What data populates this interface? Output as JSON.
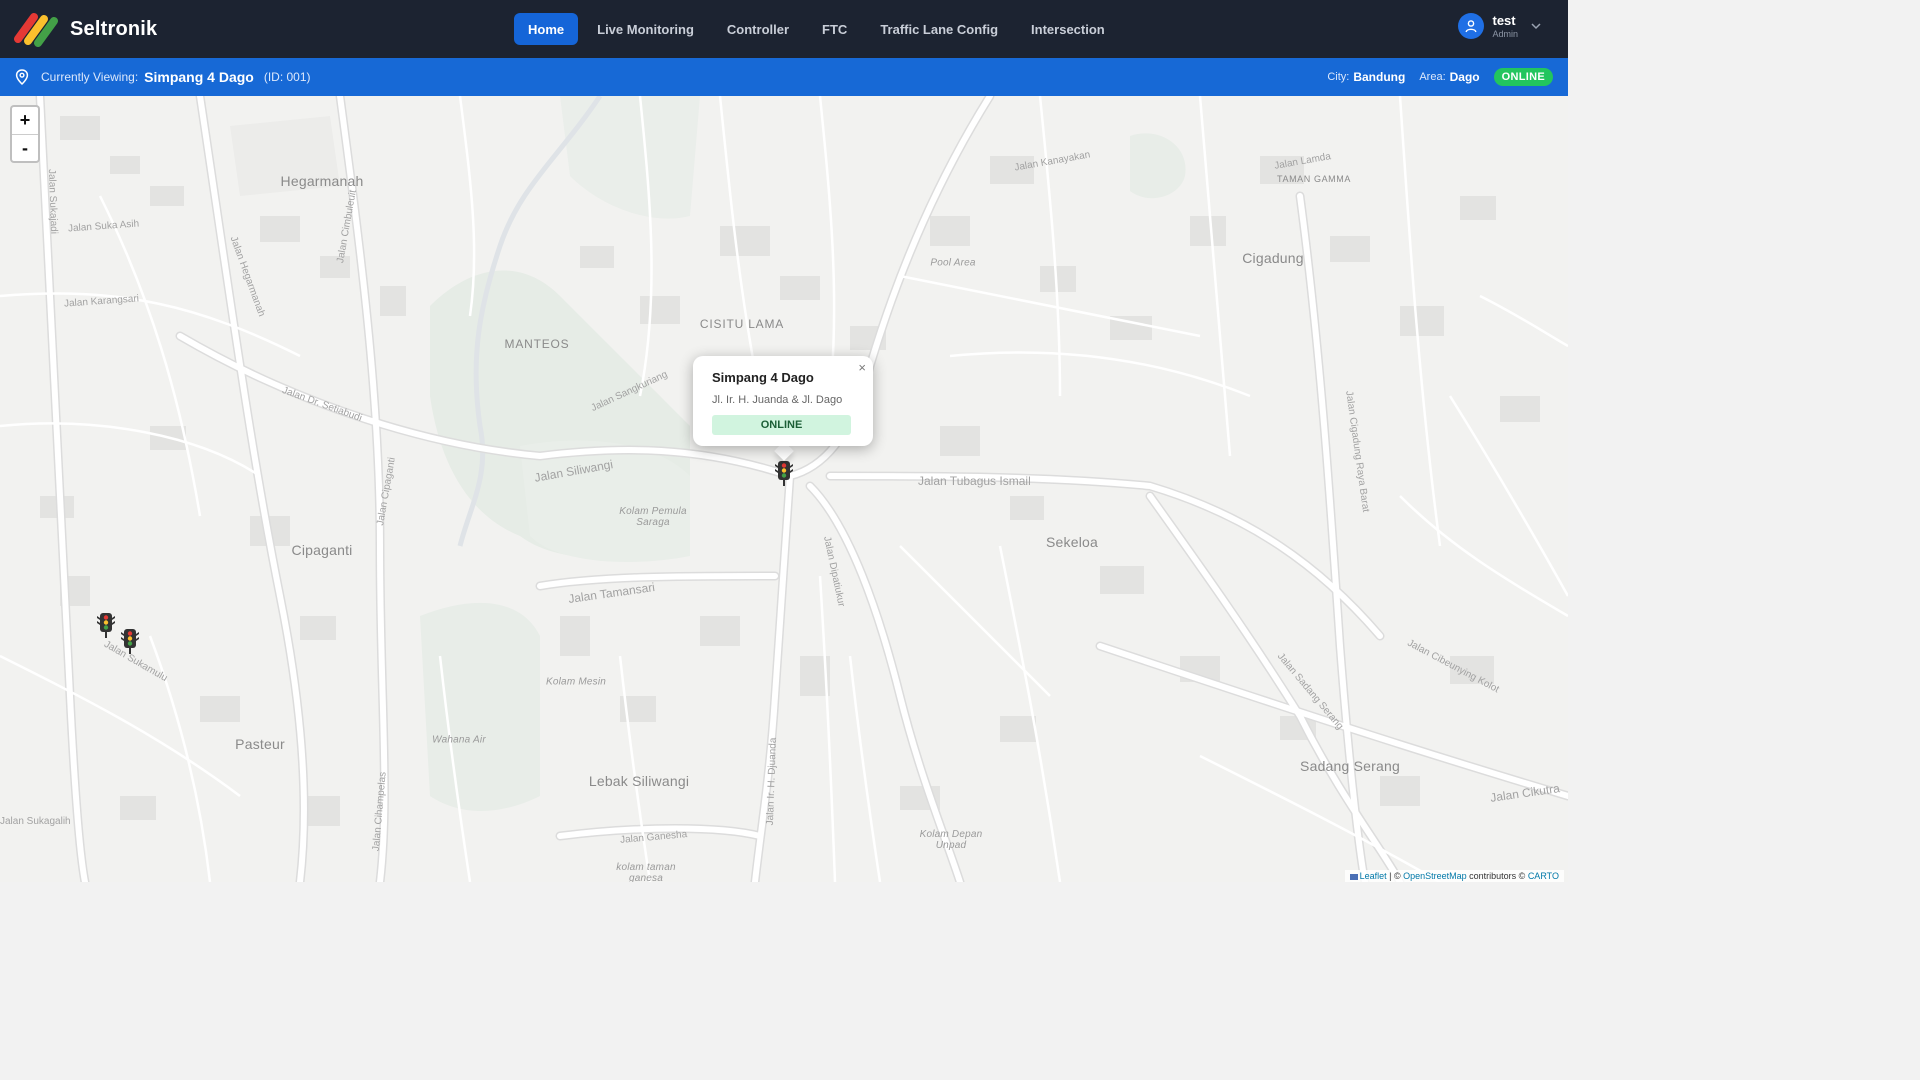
{
  "brand": {
    "name": "Seltronik",
    "logo_colors": [
      "#e53935",
      "#fbc02d",
      "#43a047"
    ]
  },
  "nav": {
    "items": [
      {
        "label": "Home",
        "active": true
      },
      {
        "label": "Live Monitoring",
        "active": false
      },
      {
        "label": "Controller",
        "active": false
      },
      {
        "label": "FTC",
        "active": false
      },
      {
        "label": "Traffic Lane Config",
        "active": false
      },
      {
        "label": "Intersection",
        "active": false
      }
    ]
  },
  "user": {
    "name": "test",
    "role": "Admin",
    "icon": "user-icon"
  },
  "status_bar": {
    "viewing_label": "Currently Viewing:",
    "intersection_name": "Simpang 4 Dago",
    "intersection_id": "(ID: 001)",
    "city_label": "City:",
    "city": "Bandung",
    "area_label": "Area:",
    "area": "Dago",
    "status": "ONLINE"
  },
  "map": {
    "zoom_in": "+",
    "zoom_out": "-",
    "places": [
      "Hegarmanah",
      "MANTEOS",
      "CISITU LAMA",
      "Cigadung",
      "Cipaganti",
      "Sekeloa",
      "Pasteur",
      "Lebak Siliwangi",
      "Sadang Serang",
      "TAMAN GAMMA",
      "Pool Area",
      "Kolam Pemula Saraga",
      "Kolam Mesin",
      "Wahana Air",
      "Kolam Depan Unpad",
      "kolam taman ganesa"
    ],
    "streets": [
      "Jalan Suka Asih",
      "Jalan Karangsari",
      "Jalan Dr. Setiabudi",
      "Jalan Hegarmanah",
      "Jalan Cimbuleuit",
      "Jalan Siliwangi",
      "Jalan Sangkuriang",
      "Jalan Tamansari",
      "Jalan Ir. H. Djuanda",
      "Jalan Dipatiukur",
      "Jalan Tubagus Ismail",
      "Jalan Cipaganti",
      "Jalan Sukajadi",
      "Jalan Sukamulu",
      "Jalan Cihampelas",
      "Jalan Ganesha",
      "Jalan Cigadung Raya Barat",
      "Jalan Sadang Serang",
      "Jalan Cibeunying Kolot",
      "Jalan Cikutra",
      "Jalan Kanayakan",
      "Jalan Lamda",
      "Jalan Sukagalih"
    ],
    "markers": [
      {
        "name": "Simpang 4 Dago",
        "selected": true
      },
      {
        "name": "Sukajadi marker A",
        "selected": false
      },
      {
        "name": "Sukajadi marker B",
        "selected": false
      }
    ]
  },
  "popup": {
    "title": "Simpang 4 Dago",
    "address": "Jl. Ir. H. Juanda & Jl. Dago",
    "status": "ONLINE",
    "close": "×"
  },
  "attribution": {
    "leaflet": "Leaflet",
    "sep": " | © ",
    "osm": "OpenStreetMap",
    "contrib": " contributors © ",
    "carto": "CARTO"
  }
}
